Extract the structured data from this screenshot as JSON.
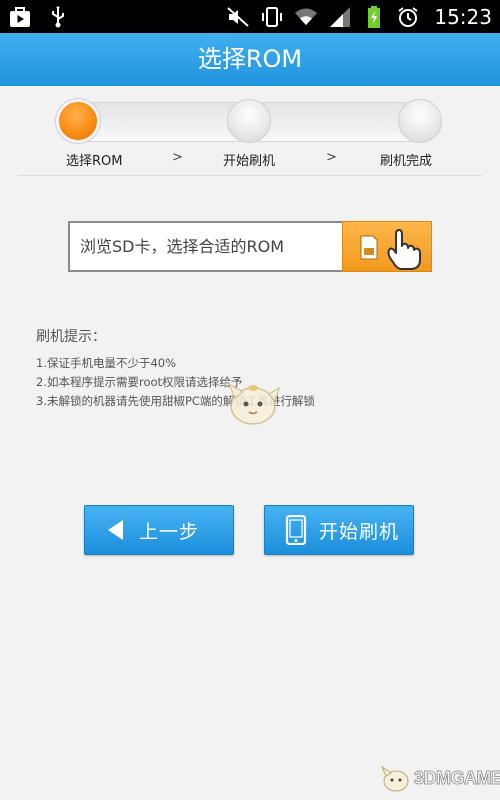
{
  "status_bar": {
    "time": "15:23",
    "left_icons": [
      "play-store-icon",
      "usb-icon"
    ],
    "right_icons": [
      "mute-icon",
      "vibrate-icon",
      "wifi-icon",
      "signal-icon",
      "battery-charging-icon",
      "alarm-icon"
    ]
  },
  "header": {
    "title": "选择ROM"
  },
  "steps": {
    "items": [
      {
        "label": "选择ROM",
        "active": true
      },
      {
        "label": "开始刷机",
        "active": false
      },
      {
        "label": "刷机完成",
        "active": false
      }
    ],
    "separator": ">"
  },
  "browse": {
    "text": "浏览SD卡，选择合适的ROM",
    "button_icon": "sd-card-hand-icon"
  },
  "tips": {
    "title": "刷机提示：",
    "items": [
      "1.保证手机电量不少于40%",
      "2.如本程序提示需要root权限请选择给予",
      "3.未解锁的机器请先使用甜椒PC端的解锁工具进行解锁"
    ]
  },
  "buttons": {
    "back_label": "上一步",
    "start_label": "开始刷机"
  },
  "watermark": {
    "text": "3DMGAME"
  },
  "colors": {
    "header_blue": "#2a9fe6",
    "accent_orange": "#f7941d",
    "button_blue": "#2196e0",
    "background": "#f2f2f2"
  }
}
